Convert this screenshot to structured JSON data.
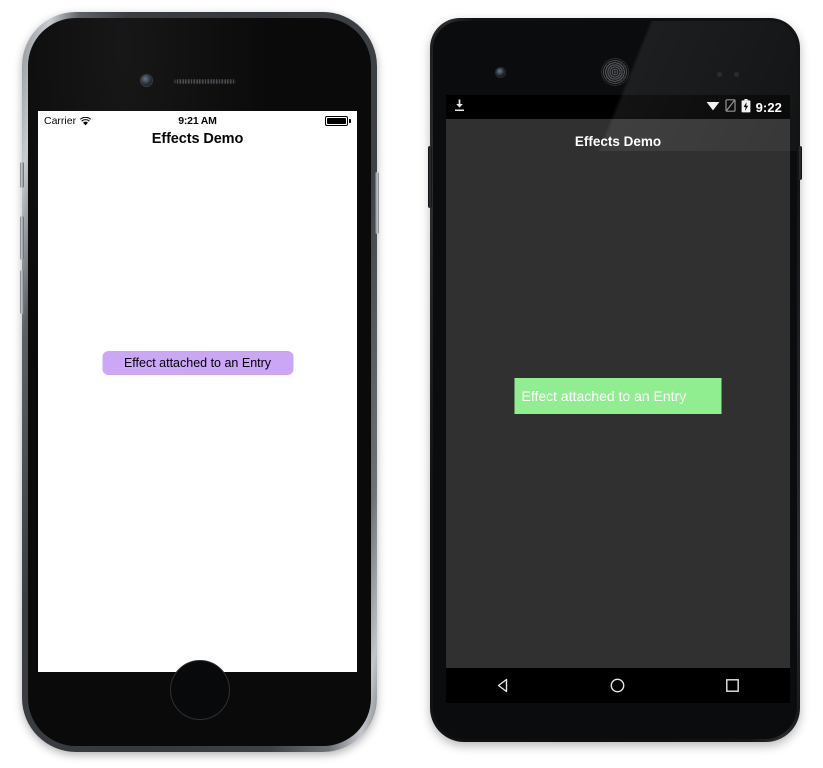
{
  "ios_device": {
    "name": "iPhone",
    "status_bar": {
      "carrier": "Carrier",
      "wifi_icon": "wifi-icon",
      "time": "9:21 AM",
      "battery_icon": "battery-full-icon"
    },
    "nav_bar": {
      "title": "Effects Demo"
    },
    "content": {
      "entry_text": "Effect attached to an Entry",
      "entry_bg_color": "#CBA6F7",
      "entry_text_color": "#000000",
      "page_bg_color": "#FFFFFF"
    },
    "hardware": {
      "camera": "front-camera",
      "speaker": "earpiece-speaker",
      "home_button": "home-button",
      "mute_switch": "mute-switch",
      "volume_up": "volume-up-button",
      "volume_down": "volume-down-button",
      "power": "power-button"
    }
  },
  "android_device": {
    "name": "Android",
    "status_bar": {
      "download_icon": "download-icon",
      "wifi_icon": "wifi-icon",
      "signal_icon": "signal-no-sim-icon",
      "battery_icon": "battery-charging-icon",
      "time": "9:22"
    },
    "app_bar": {
      "title": "Effects Demo"
    },
    "content": {
      "entry_text": "Effect attached to an Entry",
      "entry_bg_color": "#90EE90",
      "entry_text_color": "#FFFFFF",
      "page_bg_color": "#303030"
    },
    "nav_bar": {
      "back": "back-nav-icon",
      "home": "home-nav-icon",
      "recents": "recents-nav-icon"
    },
    "hardware": {
      "camera": "front-camera",
      "speaker": "earpiece-speaker",
      "sensors": "proximity-sensors",
      "volume": "volume-rocker",
      "power": "power-button"
    }
  }
}
